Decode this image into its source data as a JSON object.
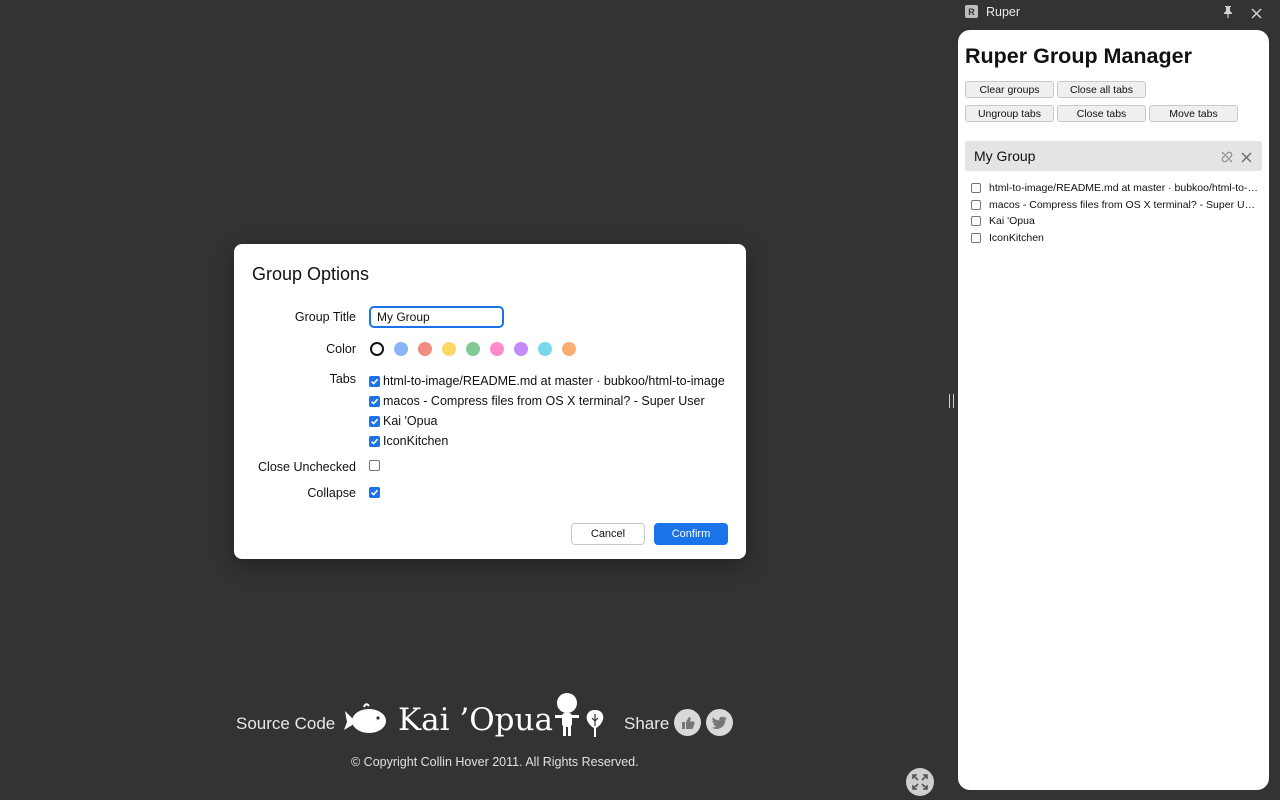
{
  "footer": {
    "source_code": "Source Code",
    "brand": "Kai ’Opua",
    "share": "Share",
    "copyright": "© Copyright Collin Hover 2011. All Rights Reserved."
  },
  "dialog": {
    "title": "Group Options",
    "group_title_label": "Group Title",
    "group_title_value": "My Group",
    "color_label": "Color",
    "colors": [
      "#ffffff",
      "#8ab4f8",
      "#f28b82",
      "#fdd663",
      "#81c995",
      "#ff8bcb",
      "#c58af9",
      "#78d9ec",
      "#fcad70"
    ],
    "selected_color_index": 0,
    "tabs_label": "Tabs",
    "tabs": [
      {
        "title": "html-to-image/README.md at master · bubkoo/html-to-image",
        "checked": true
      },
      {
        "title": "macos - Compress files from OS X terminal? - Super User",
        "checked": true
      },
      {
        "title": "Kai 'Opua",
        "checked": true
      },
      {
        "title": "IconKitchen",
        "checked": true
      }
    ],
    "close_unchecked_label": "Close Unchecked",
    "close_unchecked": false,
    "collapse_label": "Collapse",
    "collapse": true,
    "cancel_label": "Cancel",
    "confirm_label": "Confirm",
    "accent": "#1a73e8"
  },
  "side_panel": {
    "app_title": "Ruper",
    "app_icon_letter": "R",
    "heading": "Ruper Group Manager",
    "buttons": [
      "Clear groups",
      "Close all tabs",
      "Ungroup tabs",
      "Close tabs",
      "Move tabs"
    ],
    "group": {
      "name": "My Group",
      "tabs": [
        "html-to-image/README.md at master · bubkoo/html-to-image",
        "macos - Compress files from OS X terminal? - Super User",
        "Kai 'Opua",
        "IconKitchen"
      ]
    }
  }
}
